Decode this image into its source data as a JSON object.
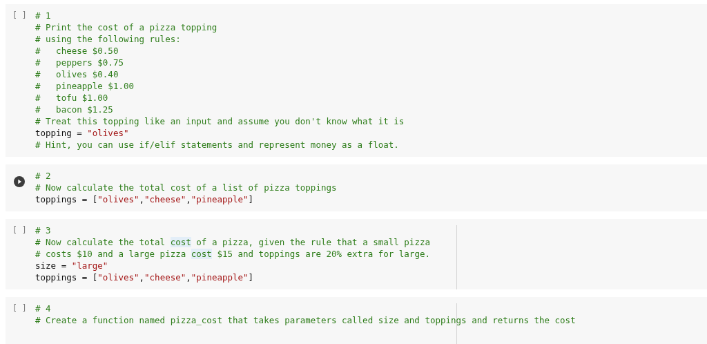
{
  "cells": [
    {
      "gutter": {
        "kind": "bracket",
        "text": "[ ]"
      },
      "ruler": false,
      "lines": [
        [
          {
            "kind": "comment",
            "text": "# 1"
          }
        ],
        [
          {
            "kind": "comment",
            "text": "# Print the cost of a pizza topping"
          }
        ],
        [
          {
            "kind": "comment",
            "text": "# using the following rules:"
          }
        ],
        [
          {
            "kind": "comment",
            "text": "#   cheese $0.50"
          }
        ],
        [
          {
            "kind": "comment",
            "text": "#   peppers $0.75"
          }
        ],
        [
          {
            "kind": "comment",
            "text": "#   olives $0.40"
          }
        ],
        [
          {
            "kind": "comment",
            "text": "#   pineapple $1.00"
          }
        ],
        [
          {
            "kind": "comment",
            "text": "#   tofu $1.00"
          }
        ],
        [
          {
            "kind": "comment",
            "text": "#   bacon $1.25"
          }
        ],
        [
          {
            "kind": "comment",
            "text": "# Treat this topping like an input and assume you don't know what it is"
          }
        ],
        [
          {
            "kind": "code",
            "text": "topping = \"olives\""
          }
        ],
        [
          {
            "kind": "comment",
            "text": "# Hint, you can use if/elif statements and represent money as a float."
          }
        ]
      ]
    },
    {
      "gutter": {
        "kind": "run_button"
      },
      "ruler": false,
      "lines": [
        [
          {
            "kind": "comment",
            "text": "# 2"
          }
        ],
        [
          {
            "kind": "comment",
            "text": "# Now calculate the total cost of a list of pizza toppings"
          }
        ],
        [
          {
            "kind": "code",
            "text": "toppings = [\"olives\",\"cheese\",\"pineapple\"]"
          }
        ]
      ]
    },
    {
      "gutter": {
        "kind": "bracket",
        "text": "[ ]"
      },
      "ruler": true,
      "lines": [
        [
          {
            "kind": "comment",
            "text": "# 3"
          }
        ],
        [
          {
            "kind": "comment",
            "text": "# Now calculate the total "
          },
          {
            "kind": "comment",
            "text": "cost",
            "highlighted": true
          },
          {
            "kind": "comment",
            "text": " of a pizza, given the rule that a small pizza"
          }
        ],
        [
          {
            "kind": "comment",
            "text": "# costs $10 and a large pizza "
          },
          {
            "kind": "comment",
            "text": "cost",
            "highlighted": true
          },
          {
            "kind": "comment",
            "text": " $15 and toppings are 20% extra for large."
          }
        ],
        [
          {
            "kind": "code",
            "text": "size = \"large\""
          }
        ],
        [
          {
            "kind": "code",
            "text": "toppings = [\"olives\",\"cheese\",\"pineapple\"]"
          }
        ]
      ]
    },
    {
      "gutter": {
        "kind": "bracket",
        "text": "[ ]"
      },
      "ruler": true,
      "lines": [
        [
          {
            "kind": "comment",
            "text": "# 4"
          }
        ],
        [
          {
            "kind": "comment",
            "text": "# Create a function named pizza_cost that takes parameters called size and toppings and returns the cost"
          }
        ]
      ]
    }
  ]
}
